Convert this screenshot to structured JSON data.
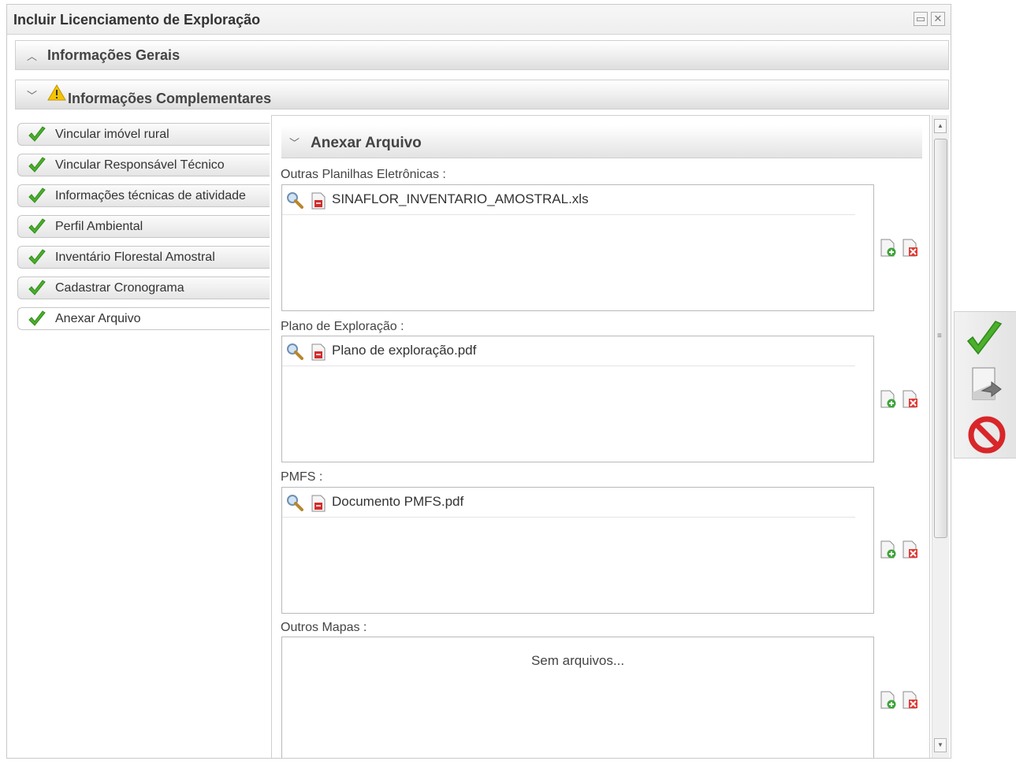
{
  "window": {
    "title": "Incluir Licenciamento de Exploração",
    "maximize_icon": "maximize-icon",
    "close_icon": "close-icon"
  },
  "sections": {
    "general": {
      "label": "Informações Gerais",
      "state": "collapsed"
    },
    "complementary": {
      "label": "Informações Complementares",
      "state": "expanded",
      "icon": "warning-icon"
    }
  },
  "nav": {
    "items": [
      {
        "label": "Vincular imóvel rural",
        "icon": "check-icon"
      },
      {
        "label": "Vincular Responsável Técnico",
        "icon": "check-icon"
      },
      {
        "label": "Informações técnicas de atividade",
        "icon": "check-icon"
      },
      {
        "label": "Perfil Ambiental",
        "icon": "check-icon"
      },
      {
        "label": "Inventário Florestal Amostral",
        "icon": "check-icon"
      },
      {
        "label": "Cadastrar Cronograma",
        "icon": "check-icon"
      },
      {
        "label": "Anexar Arquivo",
        "icon": "check-icon",
        "active": true
      }
    ]
  },
  "attach": {
    "title": "Anexar Arquivo",
    "groups": [
      {
        "label": "Outras Planilhas Eletrônicas :",
        "files": [
          "SINAFLOR_INVENTARIO_AMOSTRAL.xls"
        ]
      },
      {
        "label": "Plano de Exploração :",
        "files": [
          "Plano de exploração.pdf"
        ]
      },
      {
        "label": "PMFS :",
        "files": [
          "Documento PMFS.pdf"
        ]
      },
      {
        "label": "Outros Mapas :",
        "files": [],
        "empty_text": "Sem arquivos..."
      }
    ]
  },
  "toolbar": {
    "confirm_icon": "confirm-check-icon",
    "export_icon": "export-arrow-icon",
    "cancel_icon": "cancel-prohibited-icon"
  },
  "colors": {
    "check_green": "#3fa62a",
    "cancel_red": "#d8262a",
    "warning_yellow": "#f5c400"
  }
}
